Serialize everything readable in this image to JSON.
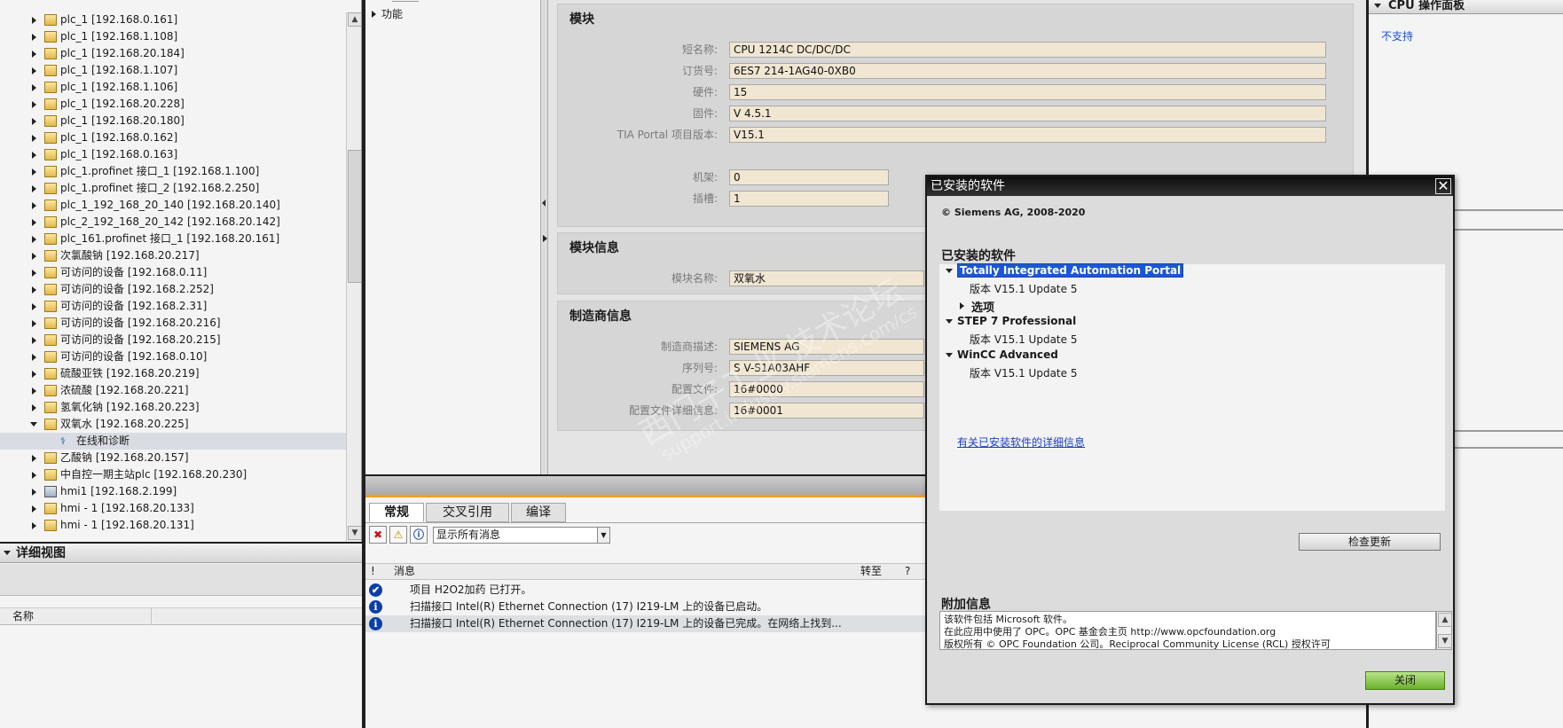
{
  "tree": {
    "items": [
      {
        "label": "plc_1 [192.168.0.161]",
        "icon": "folder-device-icon",
        "expanded": false
      },
      {
        "label": "plc_1 [192.168.1.108]",
        "icon": "folder-device-icon",
        "expanded": false
      },
      {
        "label": "plc_1 [192.168.20.184]",
        "icon": "folder-device-icon",
        "expanded": false
      },
      {
        "label": "plc_1 [192.168.1.107]",
        "icon": "folder-device-icon",
        "expanded": false
      },
      {
        "label": "plc_1 [192.168.1.106]",
        "icon": "folder-device-icon",
        "expanded": false
      },
      {
        "label": "plc_1 [192.168.20.228]",
        "icon": "folder-device-icon",
        "expanded": false
      },
      {
        "label": "plc_1 [192.168.20.180]",
        "icon": "folder-device-icon",
        "expanded": false
      },
      {
        "label": "plc_1 [192.168.0.162]",
        "icon": "folder-device-icon",
        "expanded": false
      },
      {
        "label": "plc_1 [192.168.0.163]",
        "icon": "folder-device-icon",
        "expanded": false
      },
      {
        "label": "plc_1.profinet 接口_1 [192.168.1.100]",
        "icon": "folder-device-icon",
        "expanded": false
      },
      {
        "label": "plc_1.profinet 接口_2 [192.168.2.250]",
        "icon": "folder-device-icon",
        "expanded": false
      },
      {
        "label": "plc_1_192_168_20_140 [192.168.20.140]",
        "icon": "folder-device-icon",
        "expanded": false
      },
      {
        "label": "plc_2_192_168_20_142 [192.168.20.142]",
        "icon": "folder-device-icon",
        "expanded": false
      },
      {
        "label": "plc_161.profinet 接口_1 [192.168.20.161]",
        "icon": "folder-device-icon",
        "expanded": false
      },
      {
        "label": "次氯酸钠 [192.168.20.217]",
        "icon": "folder-device-icon",
        "expanded": false
      },
      {
        "label": "可访问的设备 [192.168.0.11]",
        "icon": "folder-device-icon",
        "expanded": false
      },
      {
        "label": "可访问的设备 [192.168.2.252]",
        "icon": "folder-device-icon",
        "expanded": false
      },
      {
        "label": "可访问的设备 [192.168.2.31]",
        "icon": "folder-device-icon",
        "expanded": false
      },
      {
        "label": "可访问的设备 [192.168.20.216]",
        "icon": "folder-device-icon",
        "expanded": false
      },
      {
        "label": "可访问的设备 [192.168.20.215]",
        "icon": "folder-device-icon",
        "expanded": false
      },
      {
        "label": "可访问的设备 [192.168.0.10]",
        "icon": "folder-device-icon",
        "expanded": false
      },
      {
        "label": "硫酸亚铁 [192.168.20.219]",
        "icon": "folder-device-icon",
        "expanded": false
      },
      {
        "label": "浓硫酸 [192.168.20.221]",
        "icon": "folder-device-icon",
        "expanded": false
      },
      {
        "label": "氢氧化钠 [192.168.20.223]",
        "icon": "folder-device-icon",
        "expanded": false
      },
      {
        "label": "双氧水 [192.168.20.225]",
        "icon": "folder-device-icon",
        "expanded": true
      },
      {
        "label": "在线和诊断",
        "icon": "diagnostics-icon",
        "child": true,
        "selected": true
      },
      {
        "label": "乙酸钠 [192.168.20.157]",
        "icon": "folder-device-icon",
        "expanded": false
      },
      {
        "label": "中自控一期主站plc [192.168.20.230]",
        "icon": "folder-device-icon",
        "expanded": false
      },
      {
        "label": "hmi1 [192.168.2.199]",
        "icon": "hmi-device-icon",
        "expanded": false
      },
      {
        "label": "hmi - 1 [192.168.20.133]",
        "icon": "folder-device-icon",
        "expanded": false
      },
      {
        "label": "hmi - 1 [192.168.20.131]",
        "icon": "folder-device-icon",
        "expanded": false
      }
    ]
  },
  "detail": {
    "title": "详细视图",
    "col_name": "名称"
  },
  "nav": {
    "item": "功能"
  },
  "props": {
    "module": {
      "title": "模块",
      "rows": [
        {
          "label": "短名称:",
          "value": "CPU 1214C DC/DC/DC"
        },
        {
          "label": "订货号:",
          "value": "6ES7 214-1AG40-0XB0"
        },
        {
          "label": "硬件:",
          "value": "15"
        },
        {
          "label": "固件:",
          "value": "V 4.5.1"
        },
        {
          "label": "TIA Portal 项目版本:",
          "value": "V15.1"
        }
      ],
      "rows2": [
        {
          "label": "机架:",
          "value": "0"
        },
        {
          "label": "插槽:",
          "value": "1"
        }
      ]
    },
    "module_info": {
      "title": "模块信息",
      "label": "模块名称:",
      "value": "双氧水"
    },
    "vendor": {
      "title": "制造商信息",
      "rows": [
        {
          "label": "制造商描述:",
          "value": "SIEMENS AG"
        },
        {
          "label": "序列号:",
          "value": "S V-S1A03AHF"
        },
        {
          "label": "配置文件:",
          "value": "16#0000"
        },
        {
          "label": "配置文件详细信息:",
          "value": "16#0001"
        }
      ]
    }
  },
  "messages": {
    "tabs": [
      "常规",
      "交叉引用",
      "编译"
    ],
    "filter": "显示所有消息",
    "col_bang": "!",
    "col_msg": "消息",
    "col_goto": "转至",
    "col_q": "?",
    "rows": [
      {
        "icon": "check-icon",
        "text": "项目 H2O2加药 已打开。"
      },
      {
        "icon": "info-icon",
        "text": "扫描接口 Intel(R) Ethernet Connection (17) I219-LM 上的设备已启动。"
      },
      {
        "icon": "info-icon",
        "text": "扫描接口 Intel(R) Ethernet Connection (17) I219-LM 上的设备已完成。在网络上找到..."
      }
    ]
  },
  "right": {
    "title": "CPU 操作面板",
    "link": "不支持"
  },
  "dialog": {
    "title": "已安装的软件",
    "copyright": "© Siemens AG, 2008-2020",
    "subtitle": "已安装的软件",
    "software": [
      {
        "name": "Totally Integrated Automation Portal",
        "version": "版本 V15.1 Update 5",
        "options": "选项"
      },
      {
        "name": "STEP 7 Professional",
        "version": "版本 V15.1 Update 5"
      },
      {
        "name": "WinCC Advanced",
        "version": "版本 V15.1 Update 5"
      }
    ],
    "details_link": "有关已安装软件的详细信息",
    "check_updates": "检查更新",
    "additional_title": "附加信息",
    "additional_lines": [
      "该软件包括 Microsoft 软件。",
      "在此应用中使用了 OPC。OPC 基金会主页 http://www.opcfoundation.org",
      "版权所有 © OPC Foundation 公司。Reciprocal Community License (RCL) 授权许可"
    ],
    "close": "关闭"
  },
  "watermark": {
    "line1": "西门子工业 技术论坛",
    "line2": "support.industry.siemens.com/cs"
  },
  "colors": {
    "accent": "#f0a020",
    "link": "#1a4fd6",
    "field": "#f0e6d2",
    "ok_button": "#6ab22c"
  }
}
